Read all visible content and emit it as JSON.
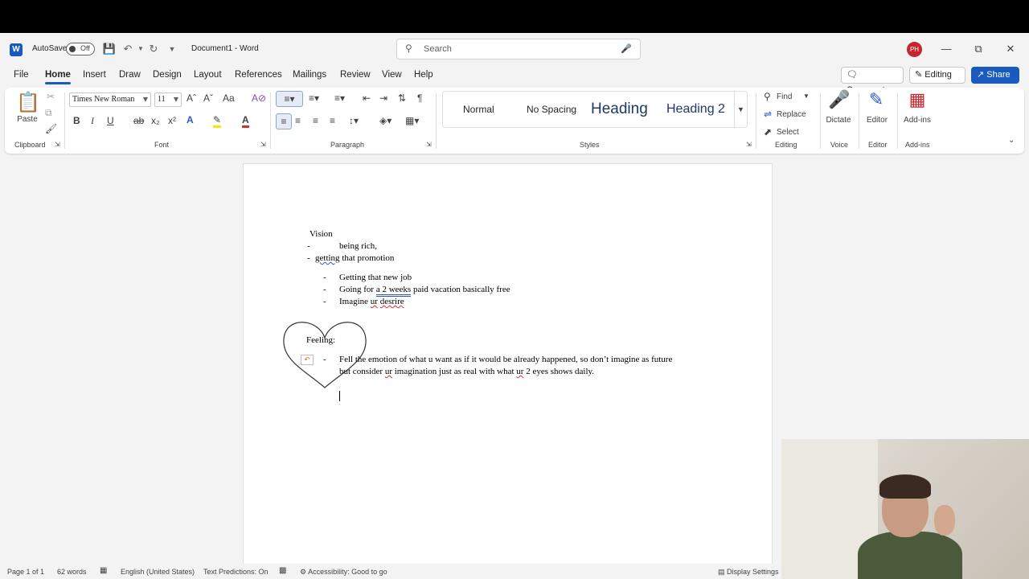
{
  "titlebar": {
    "autosave_label": "AutoSave",
    "autosave_state": "Off",
    "document_title": "Document1",
    "app_name": "Word",
    "search_placeholder": "Search",
    "user_initials": "PH"
  },
  "menu": {
    "tabs": [
      "File",
      "Home",
      "Insert",
      "Draw",
      "Design",
      "Layout",
      "References",
      "Mailings",
      "Review",
      "View",
      "Help"
    ],
    "active_tab": "Home",
    "comments_label": "Comments",
    "editing_label": "Editing",
    "share_label": "Share"
  },
  "ribbon": {
    "clipboard": {
      "paste": "Paste",
      "group": "Clipboard"
    },
    "font": {
      "family": "Times New Roman",
      "size": "11",
      "group": "Font"
    },
    "paragraph": {
      "group": "Paragraph"
    },
    "styles": {
      "items": [
        "Normal",
        "No Spacing",
        "Heading 1",
        "Heading 2"
      ],
      "visible_items": [
        "Normal",
        "No Spacing",
        "Heading",
        "Heading 2"
      ],
      "group": "Styles"
    },
    "editing": {
      "find": "Find",
      "replace": "Replace",
      "select": "Select",
      "group": "Editing"
    },
    "voice": {
      "dictate": "Dictate",
      "group": "Voice"
    },
    "editor": {
      "label": "Editor",
      "group": "Editor"
    },
    "addins": {
      "label": "Add-ins",
      "group": "Add-ins"
    }
  },
  "document": {
    "heading_vision": "Vision",
    "dash": "-",
    "item_rich": "being rich,",
    "item_promotion_a": "getting",
    "item_promotion_b": " that promotion",
    "bullets": [
      {
        "text": "Getting that new job"
      },
      {
        "pre": "Going for ",
        "underlined": "a 2 weeks",
        "post": " paid vacation basically free"
      },
      {
        "pre": "Imagine ",
        "red1": "ur",
        "mid": " ",
        "red2": "desrire"
      }
    ],
    "heading_feeling": "Feeling:",
    "feeling_line1": "Fell the emotion of what u want as if it would be already happened, so don’t imagine as future",
    "feeling_line2_a": "but consider ",
    "feeling_line2_ur": "ur",
    "feeling_line2_b": " imagination just as real with what ",
    "feeling_line2_ur2": "ur",
    "feeling_line2_c": " 2 eyes shows daily."
  },
  "statusbar": {
    "page": "Page 1 of 1",
    "words": "62 words",
    "language": "English (United States)",
    "predictions": "Text Predictions: On",
    "accessibility": "Accessibility: Good to go",
    "display": "Display Settings"
  },
  "colors": {
    "accent": "#185abd",
    "avatar": "#c4262e",
    "heading_style": "#1f3864"
  }
}
